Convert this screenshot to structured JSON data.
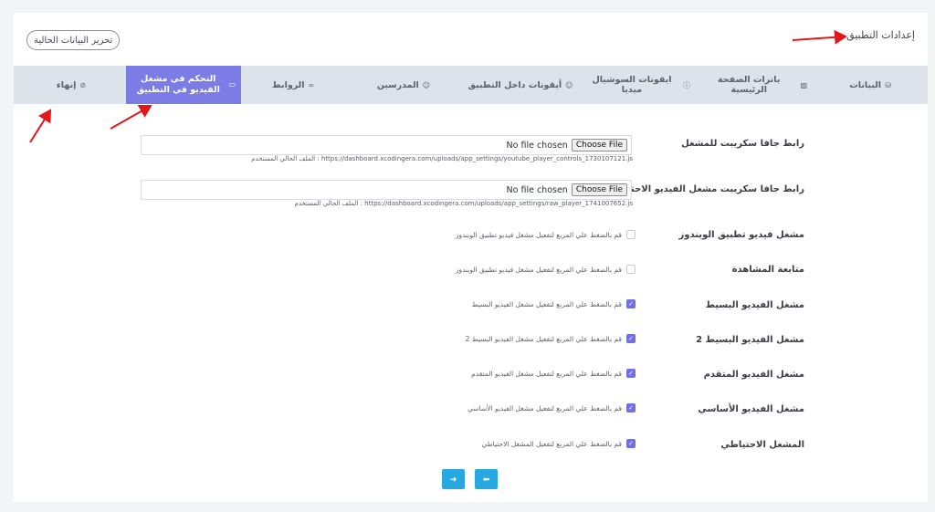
{
  "header": {
    "title": "إعدادات التطبيق",
    "edit_button": "تحرير البيانات الحالية"
  },
  "tabs": [
    {
      "label": "البيانات",
      "icon": "database-icon",
      "glyph": "⛁",
      "active": false
    },
    {
      "label": "بانرات الصفحة الرئيسية",
      "icon": "image-icon",
      "glyph": "▨",
      "active": false
    },
    {
      "label": "ايقونات السوشيال ميديا",
      "icon": "info-icon",
      "glyph": "ⓘ",
      "active": false
    },
    {
      "label": "أيقونات داخل التطبيق",
      "icon": "user-icon",
      "glyph": "☺",
      "active": false
    },
    {
      "label": "المدرسين",
      "icon": "user-icon",
      "glyph": "☺",
      "active": false
    },
    {
      "label": "الروابط",
      "icon": "link-icon",
      "glyph": "∞",
      "active": false
    },
    {
      "label": "التحكم في مشغل الفيديو في التطبيق",
      "icon": "video-icon",
      "glyph": "▭",
      "active": true
    },
    {
      "label": "إنهاء",
      "icon": "check-circle-icon",
      "glyph": "⊘",
      "active": false
    }
  ],
  "files": [
    {
      "label": "رابط جافا سكريبت للمشغل",
      "button": "Choose File",
      "status": "No file chosen",
      "note": "الملف الحالي المستخدم : https://dashboard.xcodingera.com/uploads/app_settings/youtube_player_controls_1730107121.js"
    },
    {
      "label": "رابط جافا سكريبت مشغل الفيديو الاحتياطي",
      "button": "Choose File",
      "status": "No file chosen",
      "note": "الملف الحالي المستخدم : https://dashboard.xcodingera.com/uploads/app_settings/raw_player_1741007652.js"
    }
  ],
  "toggles": [
    {
      "label": "مشغل فيديو تطبيق الويندوز",
      "hint": "قم بالضغط علي المربع لتفعيل مشغل فيديو تطبيق الويندوز",
      "checked": false
    },
    {
      "label": "متابعة المشاهدة",
      "hint": "قم بالضغط علي المربع لتفعيل مشغل فيديو تطبيق الويندوز",
      "checked": false
    },
    {
      "label": "مشغل الفيديو البسيط",
      "hint": "قم بالضغط علي المربع لتفعيل مشغل الفيديو البسيط",
      "checked": true
    },
    {
      "label": "مشغل الفيديو البسيط 2",
      "hint": "قم بالضغط علي المربع لتفعيل مشغل الفيديو البسيط 2",
      "checked": true
    },
    {
      "label": "مشغل الفيديو المتقدم",
      "hint": "قم بالضغط علي المربع لتفعيل مشغل الفيديو المتقدم",
      "checked": true
    },
    {
      "label": "مشغل الفيديو الأساسي",
      "hint": "قم بالضغط علي المربع لتفعيل مشغل الفيديو الأساسي",
      "checked": true
    },
    {
      "label": "المشغل الاحتياطي",
      "hint": "قم بالضغط علي المربع لتفعيل المشغل الاحتياطي",
      "checked": true
    }
  ],
  "nav": {
    "next_glyph": "➜",
    "prev_glyph": "⬅"
  },
  "colors": {
    "accent": "#7c7ce6",
    "nav_button": "#28a8e0",
    "annotation": "#e3161b"
  }
}
